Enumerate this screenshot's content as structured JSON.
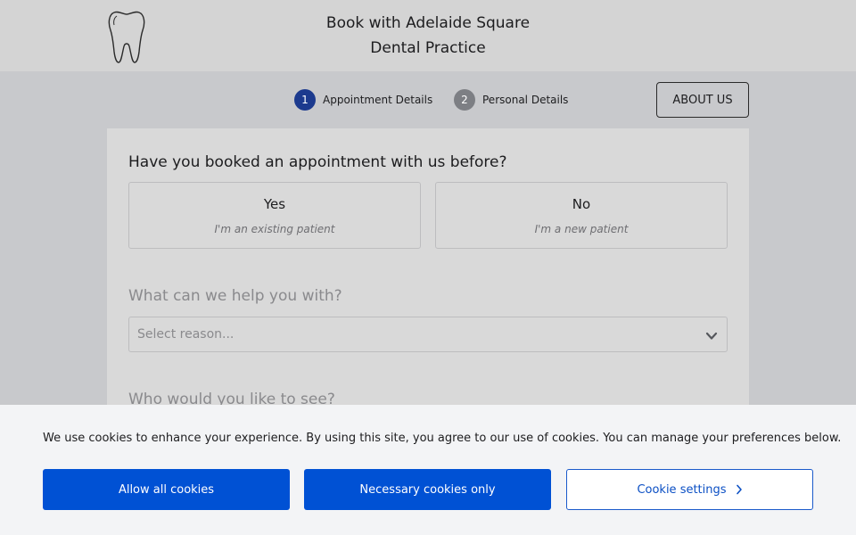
{
  "header": {
    "logo_icon": "tooth-icon",
    "title_line1": "Book with Adelaide Square",
    "title_line2": "Dental Practice"
  },
  "steps": [
    {
      "number": "1",
      "label": "Appointment Details",
      "state": "active"
    },
    {
      "number": "2",
      "label": "Personal Details",
      "state": "inactive"
    }
  ],
  "about_button": {
    "label": "ABOUT US"
  },
  "form": {
    "question_booked": "Have you booked an appointment with us before?",
    "choices": [
      {
        "title": "Yes",
        "subtitle": "I'm an existing patient"
      },
      {
        "title": "No",
        "subtitle": "I'm a new patient"
      }
    ],
    "question_help": "What can we help you with?",
    "reason_select": {
      "placeholder": "Select reason...",
      "icon": "chevron-down-icon"
    },
    "question_who": "Who would you like to see?"
  },
  "cookie_banner": {
    "message": "We use cookies to enhance your experience. By using this site, you agree to our use of cookies. You can manage your preferences below.",
    "allow_all_label": "Allow all cookies",
    "necessary_only_label": "Necessary cookies only",
    "settings_label": "Cookie settings",
    "settings_icon": "chevron-right-icon"
  },
  "colors": {
    "primary": "#0051d4",
    "step_active": "#1c3a8e",
    "step_inactive": "#7d7f84"
  }
}
